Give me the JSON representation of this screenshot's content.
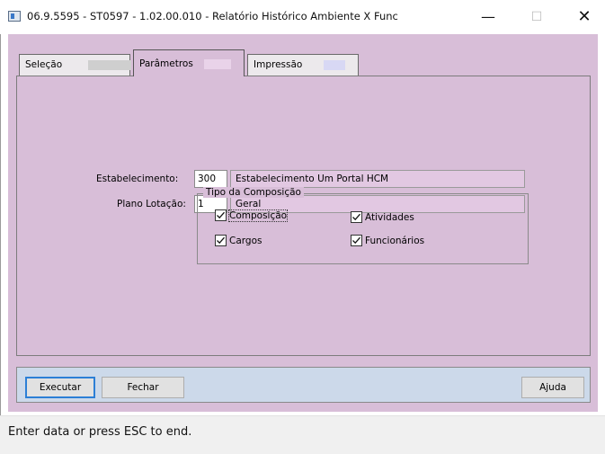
{
  "window": {
    "title": "06.9.5595 - ST0597 - 1.02.00.010 - Relatório Histórico Ambiente X Func",
    "minimize_glyph": "—",
    "maximize_glyph": "☐",
    "close_glyph": "✕"
  },
  "tabs": [
    {
      "label": "Seleção",
      "active": false
    },
    {
      "label": "Parâmetros",
      "active": true
    },
    {
      "label": "Impressão",
      "active": false
    }
  ],
  "form": {
    "estabelecimento": {
      "label": "Estabelecimento:",
      "value": "300",
      "description": "Estabelecimento Um Portal HCM"
    },
    "plano_lotacao": {
      "label": "Plano Lotação:",
      "value": "1",
      "description": "Geral"
    }
  },
  "tipo_composicao": {
    "title": "Tipo da Composição",
    "options": [
      {
        "label": "Composição",
        "checked": true
      },
      {
        "label": "Atividades",
        "checked": true
      },
      {
        "label": "Cargos",
        "checked": true
      },
      {
        "label": "Funcionários",
        "checked": true
      }
    ]
  },
  "buttons": {
    "executar": "Executar",
    "fechar": "Fechar",
    "ajuda": "Ajuda"
  },
  "status": {
    "text": "Enter data or press ESC to end."
  },
  "colors": {
    "background": "#d8bed8",
    "button_bar": "#ccd9ea",
    "default_button_border": "#2c7fd6"
  },
  "icons": {
    "app": "app-window-icon",
    "check": "checkmark-icon"
  }
}
